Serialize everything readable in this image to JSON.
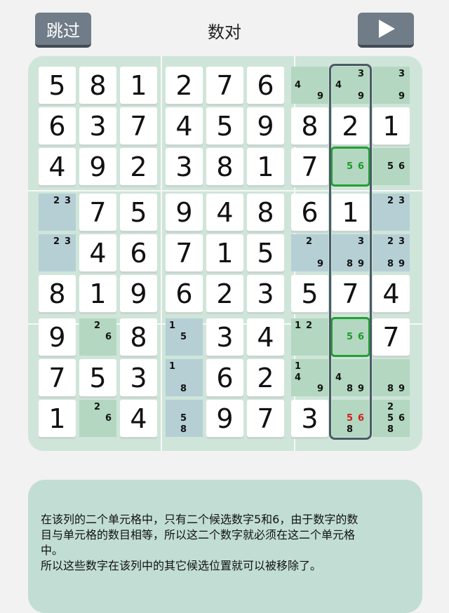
{
  "header": {
    "skip_label": "跳过",
    "title": "数对",
    "play_icon": "play-icon"
  },
  "board": {
    "cells": [
      [
        {
          "v": "5"
        },
        {
          "v": "8"
        },
        {
          "v": "1"
        },
        {
          "v": "2"
        },
        {
          "v": "7"
        },
        {
          "v": "6"
        },
        {
          "c": [
            "4",
            "9"
          ],
          "bg": "cand"
        },
        {
          "c": [
            "3",
            "4",
            "9"
          ],
          "bg": "cand"
        },
        {
          "c": [
            "3",
            "9"
          ],
          "bg": "cand"
        }
      ],
      [
        {
          "v": "6"
        },
        {
          "v": "3"
        },
        {
          "v": "7"
        },
        {
          "v": "4"
        },
        {
          "v": "5"
        },
        {
          "v": "9"
        },
        {
          "v": "8"
        },
        {
          "v": "2"
        },
        {
          "v": "1"
        }
      ],
      [
        {
          "v": "4"
        },
        {
          "v": "9"
        },
        {
          "v": "2"
        },
        {
          "v": "3"
        },
        {
          "v": "8"
        },
        {
          "v": "1"
        },
        {
          "v": "7"
        },
        {
          "c": [
            "5",
            "6"
          ],
          "bg": "cand",
          "hl": true,
          "color": "green"
        },
        {
          "c": [
            "5",
            "6"
          ],
          "bg": "cand"
        }
      ],
      [
        {
          "c": [
            "2",
            "3"
          ],
          "bg": "blue"
        },
        {
          "v": "7"
        },
        {
          "v": "5"
        },
        {
          "v": "9"
        },
        {
          "v": "4"
        },
        {
          "v": "8"
        },
        {
          "v": "6"
        },
        {
          "v": "1"
        },
        {
          "c": [
            "2",
            "3"
          ],
          "bg": "blue"
        }
      ],
      [
        {
          "c": [
            "2",
            "3"
          ],
          "bg": "blue"
        },
        {
          "v": "4"
        },
        {
          "v": "6"
        },
        {
          "v": "7"
        },
        {
          "v": "1"
        },
        {
          "v": "5"
        },
        {
          "c": [
            "2",
            "9"
          ],
          "bg": "blue"
        },
        {
          "c": [
            "3",
            "8",
            "9"
          ],
          "bg": "blue"
        },
        {
          "c": [
            "2",
            "3",
            "8",
            "9"
          ],
          "bg": "blue"
        }
      ],
      [
        {
          "v": "8"
        },
        {
          "v": "1"
        },
        {
          "v": "9"
        },
        {
          "v": "6"
        },
        {
          "v": "2"
        },
        {
          "v": "3"
        },
        {
          "v": "5"
        },
        {
          "v": "7"
        },
        {
          "v": "4"
        }
      ],
      [
        {
          "v": "9"
        },
        {
          "c": [
            "2",
            "6"
          ],
          "bg": "cand"
        },
        {
          "v": "8"
        },
        {
          "c": [
            "1",
            "5"
          ],
          "bg": "blue"
        },
        {
          "v": "3"
        },
        {
          "v": "4"
        },
        {
          "c": [
            "1",
            "2"
          ],
          "bg": "cand"
        },
        {
          "c": [
            "5",
            "6"
          ],
          "bg": "cand",
          "hl": true,
          "color": "green"
        },
        {
          "v": "7"
        }
      ],
      [
        {
          "v": "7"
        },
        {
          "v": "5"
        },
        {
          "v": "3"
        },
        {
          "c": [
            "1",
            "8"
          ],
          "bg": "blue"
        },
        {
          "v": "6"
        },
        {
          "v": "2"
        },
        {
          "c": [
            "1",
            "4",
            "9"
          ],
          "bg": "cand"
        },
        {
          "c": [
            "4",
            "8",
            "9"
          ],
          "bg": "cand"
        },
        {
          "c": [
            "8",
            "9"
          ],
          "bg": "cand"
        }
      ],
      [
        {
          "v": "1"
        },
        {
          "c": [
            "2",
            "6"
          ],
          "bg": "cand"
        },
        {
          "v": "4"
        },
        {
          "c": [
            "5",
            "8"
          ],
          "bg": "blue"
        },
        {
          "v": "9"
        },
        {
          "v": "7"
        },
        {
          "v": "3"
        },
        {
          "c": [
            "5",
            "6",
            "8"
          ],
          "bg": "cand",
          "color": "red"
        },
        {
          "c": [
            "2",
            "5",
            "6",
            "8"
          ],
          "bg": "cand"
        }
      ]
    ]
  },
  "info": {
    "lines": [
      "在该列的二个单元格中，只有二个候选数字5和6，由于数字的数",
      "目与单元格的数目相等，所以这二个数字就必须在这二个单元格",
      "中。",
      "所以这些数字在该列中的其它候选位置就可以被移除了。"
    ]
  }
}
